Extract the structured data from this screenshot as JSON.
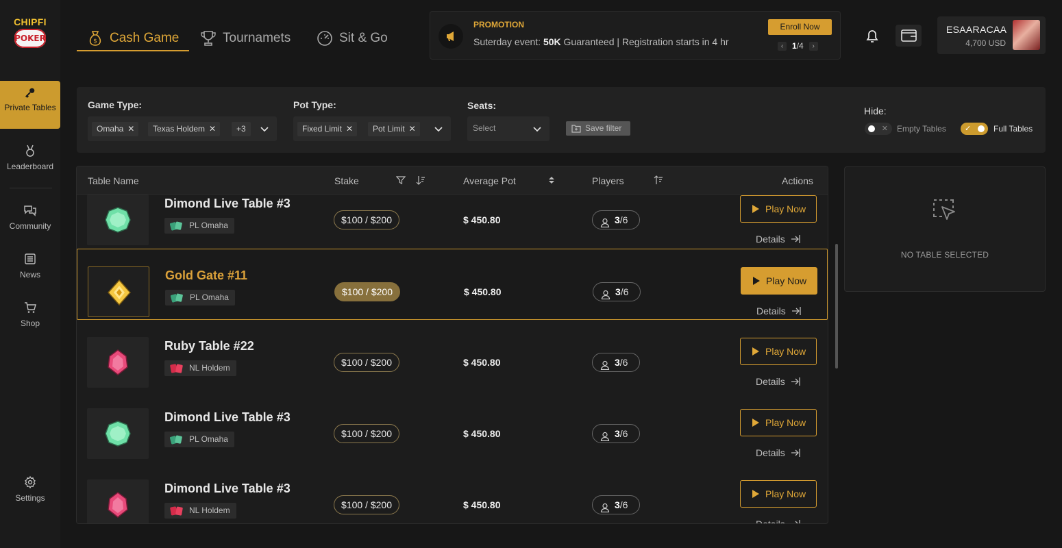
{
  "brand": {
    "line1": "CHIPFI",
    "line2": "POKER"
  },
  "sidebar": {
    "items": [
      {
        "label": "Private Tables",
        "icon": "key-icon",
        "active": true
      },
      {
        "label": "Leaderboard",
        "icon": "medal-icon",
        "active": false
      },
      {
        "label": "Community",
        "icon": "chat-icon",
        "active": false
      },
      {
        "label": "News",
        "icon": "newspaper-icon",
        "active": false
      },
      {
        "label": "Shop",
        "icon": "cart-icon",
        "active": false
      },
      {
        "label": "Settings",
        "icon": "gear-icon",
        "active": false
      }
    ]
  },
  "tabs": [
    {
      "label": "Cash Game",
      "icon": "money-bag-icon",
      "active": true
    },
    {
      "label": "Tournamets",
      "icon": "trophy-icon",
      "active": false
    },
    {
      "label": "Sit & Go",
      "icon": "speedometer-icon",
      "active": false
    }
  ],
  "promo": {
    "title": "PROMOTION",
    "text_before": "Suterday event: ",
    "text_bold": "50K",
    "text_after": " Guaranteed | Registration starts in 4 hr",
    "enroll_label": "Enroll Now",
    "page_current": "1",
    "page_total": "/4"
  },
  "user": {
    "name": "ESAARACAA",
    "balance": "4,700 USD"
  },
  "filters": {
    "game_type_label": "Game Type:",
    "game_type_chips": [
      "Omaha",
      "Texas Holdem"
    ],
    "game_type_more": "+3",
    "pot_type_label": "Pot Type:",
    "pot_type_chips": [
      "Fixed Limit",
      "Pot Limit"
    ],
    "seats_label": "Seats:",
    "seats_placeholder": "Select",
    "save_label": "Save filter",
    "hide_label": "Hide:",
    "empty_tables_label": "Empty Tables",
    "full_tables_label": "Full Tables",
    "empty_tables_on": false,
    "full_tables_on": true
  },
  "table": {
    "headers": {
      "name": "Table Name",
      "stake": "Stake",
      "avg_pot": "Average Pot",
      "players": "Players",
      "actions": "Actions"
    },
    "play_label": "Play Now",
    "details_label": "Details",
    "rows": [
      {
        "name": "Dimond Live Table #3",
        "tag": "PL Omaha",
        "gem": "diamond",
        "stake": "$100 / $200",
        "avg_pot": "$ 450.80",
        "players_current": "3",
        "players_max": "/6",
        "selected": false
      },
      {
        "name": "Gold Gate #11",
        "tag": "PL Omaha",
        "gem": "gold",
        "stake": "$100 / $200",
        "avg_pot": "$ 450.80",
        "players_current": "3",
        "players_max": "/6",
        "selected": true
      },
      {
        "name": "Ruby Table #22",
        "tag": "NL Holdem",
        "gem": "ruby",
        "stake": "$100 / $200",
        "avg_pot": "$ 450.80",
        "players_current": "3",
        "players_max": "/6",
        "selected": false
      },
      {
        "name": "Dimond Live Table #3",
        "tag": "PL Omaha",
        "gem": "diamond",
        "stake": "$100 / $200",
        "avg_pot": "$ 450.80",
        "players_current": "3",
        "players_max": "/6",
        "selected": false
      },
      {
        "name": "Dimond Live Table #3",
        "tag": "NL Holdem",
        "gem": "ruby",
        "stake": "$100 / $200",
        "avg_pot": "$ 450.80",
        "players_current": "3",
        "players_max": "/6",
        "selected": false
      }
    ]
  },
  "detail_panel": {
    "message": "NO TABLE SELECTED"
  },
  "colors": {
    "accent": "#d69d30",
    "background": "#171717",
    "panel": "#222222",
    "ruby": "#e84a7a",
    "diamond": "#6fe0a8"
  }
}
